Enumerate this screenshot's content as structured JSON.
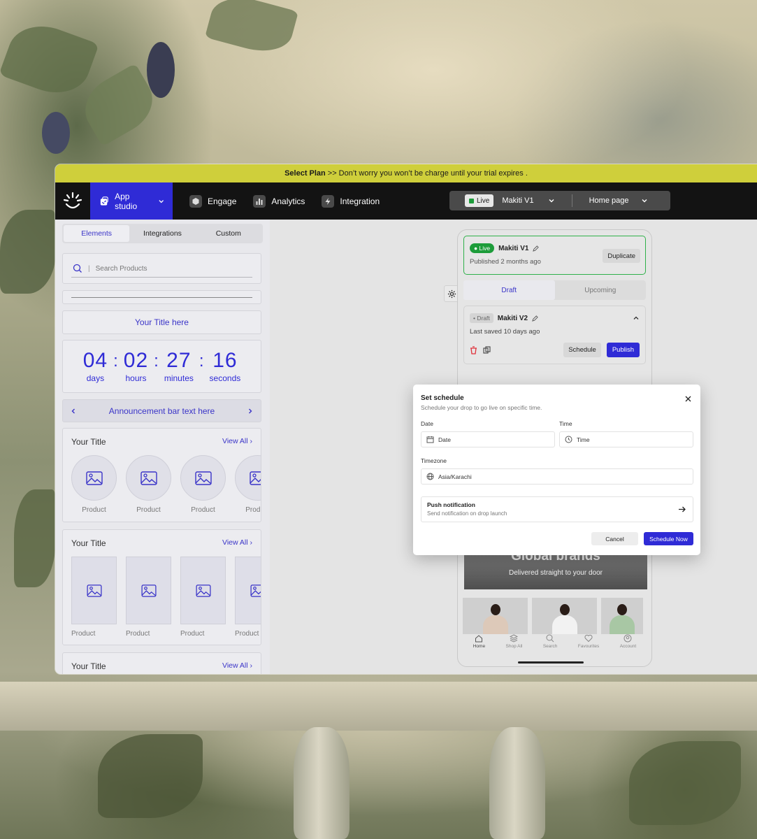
{
  "promo": {
    "bold": "Select Plan",
    "text": ">> Don’t worry you won’t be charge until your trial expires ."
  },
  "nav": {
    "app_studio": "App studio",
    "engage": "Engage",
    "analytics": "Analytics",
    "integration": "Integration",
    "env_badge": "Live",
    "env_name": "Makiti V1",
    "page_select": "Home page"
  },
  "panel": {
    "tabs": [
      "Elements",
      "Integrations",
      "Custom"
    ],
    "search_placeholder": "Search Products",
    "title_block": "Your Title here",
    "timer": {
      "days": "04",
      "hours": "02",
      "minutes": "27",
      "seconds": "16",
      "days_label": "days",
      "hours_label": "hours",
      "minutes_label": "minutes",
      "seconds_label": "seconds"
    },
    "announcement": "Announcement bar text here",
    "sections": [
      {
        "title": "Your Title",
        "view_all": "View All",
        "items": [
          "Product",
          "Product",
          "Product",
          "Product"
        ]
      },
      {
        "title": "Your Title",
        "view_all": "View All",
        "items": [
          "Product",
          "Product",
          "Product",
          "Product"
        ]
      },
      {
        "title": "Your Title",
        "view_all": "View All"
      }
    ]
  },
  "preview": {
    "live": {
      "badge": "Live",
      "name": "Makiti V1",
      "sub": "Published 2 months ago",
      "duplicate": "Duplicate"
    },
    "tabs": [
      "Draft",
      "Upcoming"
    ],
    "draft": {
      "badge": "Draft",
      "name": "Makiti V2",
      "sub": "Last saved 10 days ago",
      "schedule": "Schedule",
      "publish": "Publish"
    },
    "hero_title": "Global brands",
    "hero_sub": "Delivered straight to your door",
    "tabbar": [
      "Home",
      "Shop All",
      "Search",
      "Favourites",
      "Account"
    ]
  },
  "modal": {
    "title": "Set schedule",
    "subtitle": "Schedule your drop to go live on specific time.",
    "date_label": "Date",
    "date_placeholder": "Date",
    "time_label": "Time",
    "time_placeholder": "Time",
    "timezone_label": "Timezone",
    "timezone_value": "Asia/Karachi",
    "push_title": "Push notification",
    "push_sub": "Send notification on drop launch",
    "cancel": "Cancel",
    "schedule_now": "Schedule Now"
  },
  "colors": {
    "accent": "#2f2bd6",
    "promo": "#cfcf3b",
    "nav_bg": "#131313",
    "live_green": "#1d9c3a"
  }
}
